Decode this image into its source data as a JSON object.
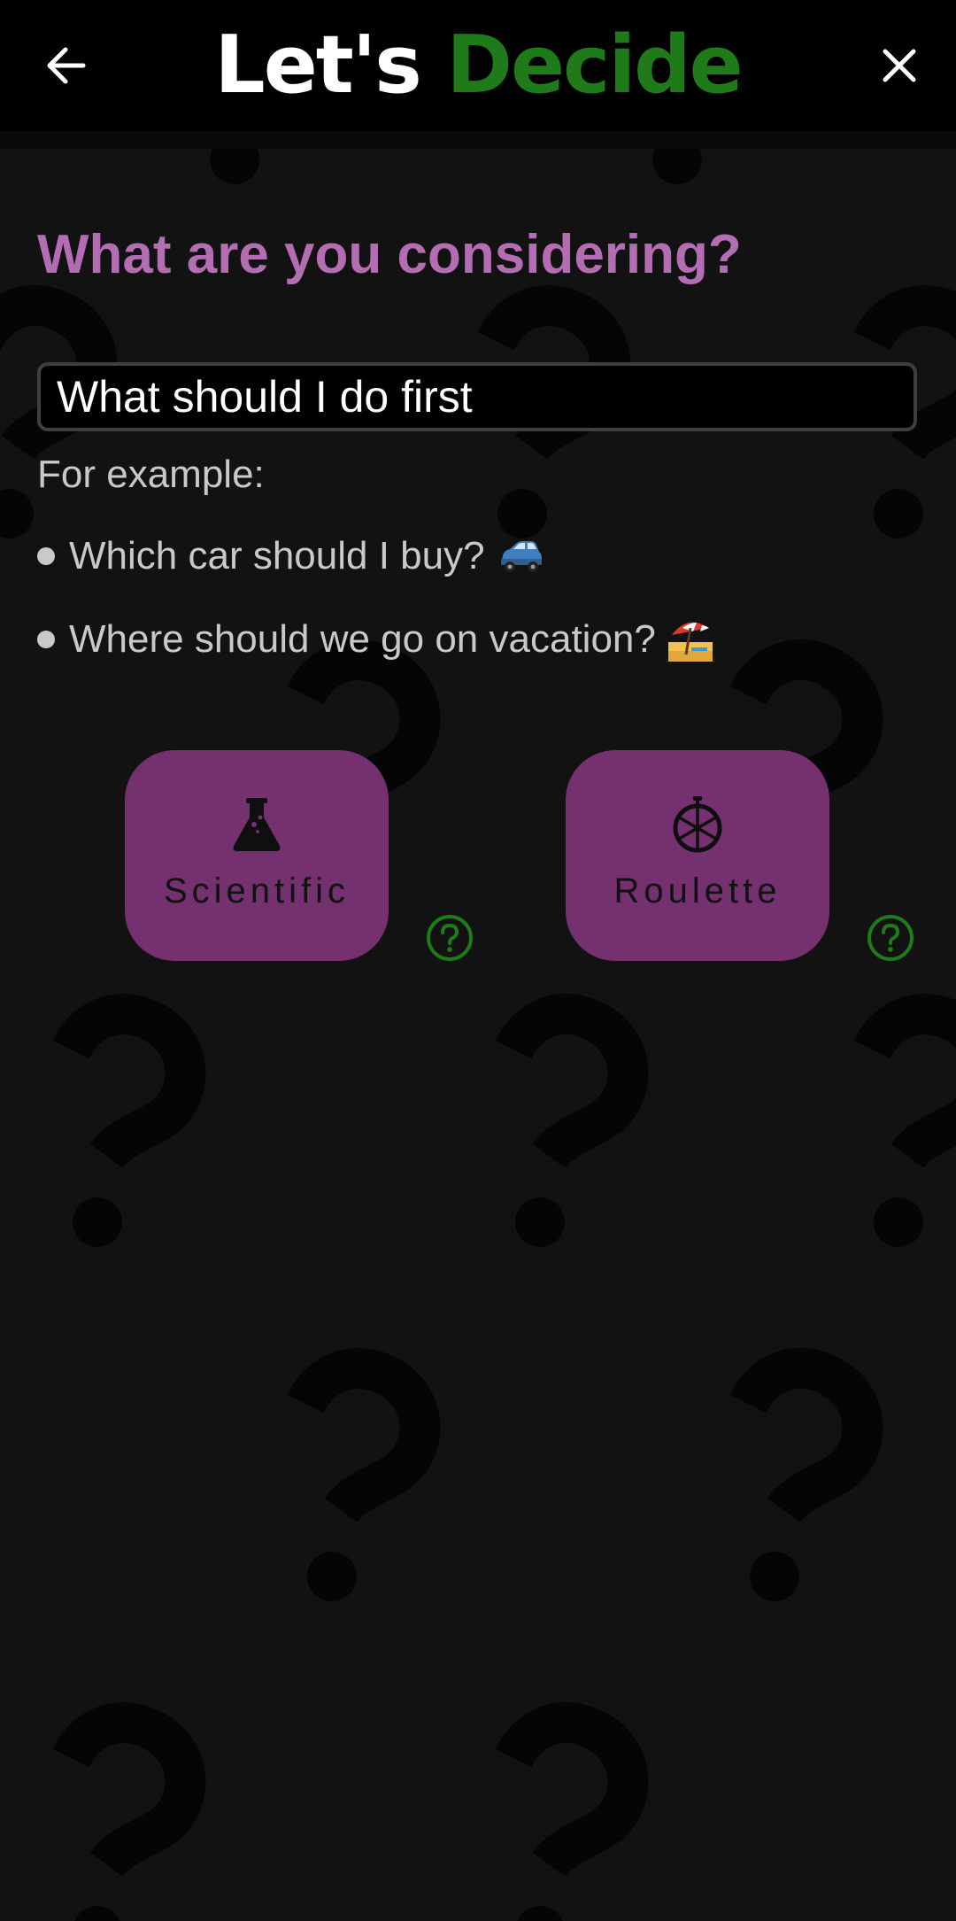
{
  "header": {
    "title_part1": "Let's",
    "title_part2": "Decide",
    "back_icon": "arrow-left-icon",
    "close_icon": "close-icon",
    "accent_color": "#1f7a1a"
  },
  "main": {
    "heading": "What are you considering?",
    "input": {
      "value": "What should I do first",
      "placeholder": ""
    },
    "examples_label": "For example:",
    "examples": [
      {
        "text": "Which car should I buy?",
        "emoji": "car-emoji"
      },
      {
        "text": "Where should we go on vacation?",
        "emoji": "beach-umbrella-emoji"
      }
    ],
    "methods": [
      {
        "label": "Scientific",
        "icon": "flask-icon",
        "help_icon": "help-circle-icon"
      },
      {
        "label": "Roulette",
        "icon": "wheel-icon",
        "help_icon": "help-circle-icon"
      }
    ]
  },
  "colors": {
    "background": "#121212",
    "heading": "#b46db2",
    "button": "#74306f",
    "help": "#1f7a1a"
  }
}
